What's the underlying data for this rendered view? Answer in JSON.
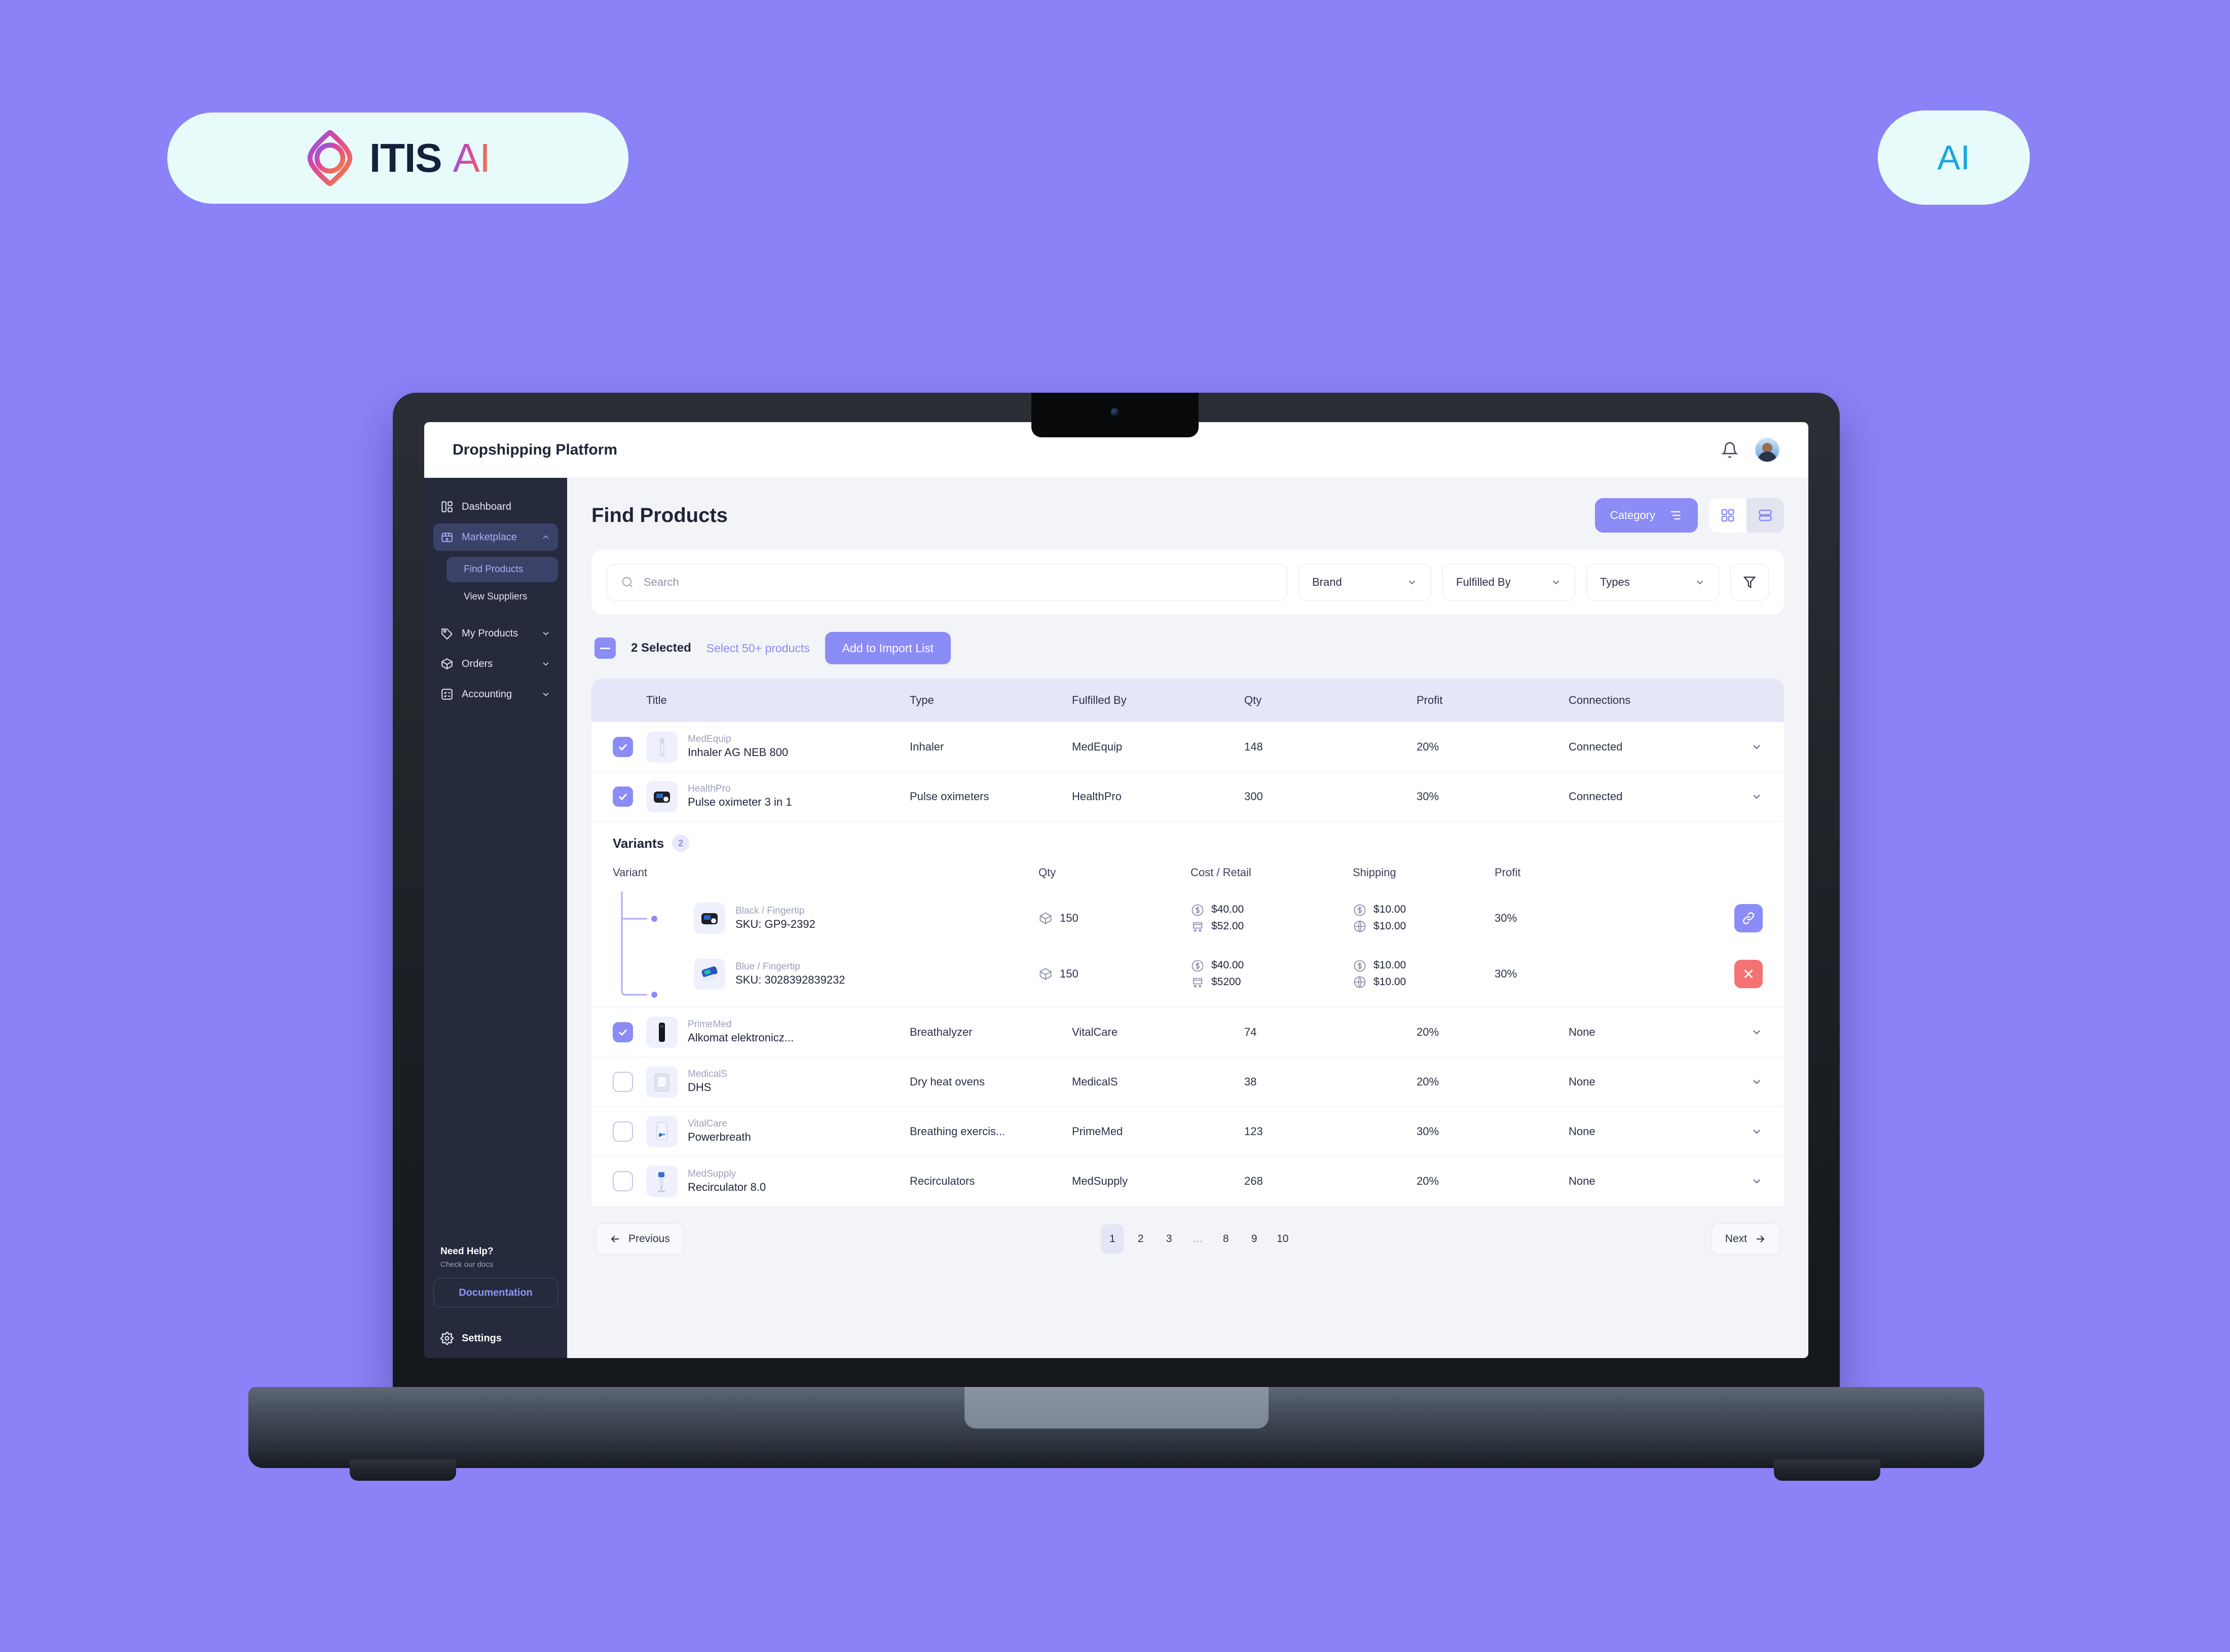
{
  "branding": {
    "logo_text": "ITIS",
    "logo_accent": "AI",
    "badge_text": "AI",
    "accent_color": "#8b8cf5",
    "background_color": "#8b82f8",
    "pill_background": "#e8fbfb",
    "badge_color": "#19a7dd"
  },
  "appbar": {
    "title": "Dropshipping Platform",
    "bell_icon": "bell-icon",
    "avatar_icon": "avatar"
  },
  "sidebar": {
    "items": [
      {
        "label": "Dashboard",
        "icon": "layout-dashboard-icon",
        "active": false,
        "chevron": ""
      },
      {
        "label": "Marketplace",
        "icon": "marketplace-icon",
        "active": true,
        "chevron": "up"
      },
      {
        "label": "My Products",
        "icon": "tag-icon",
        "active": false,
        "chevron": "down"
      },
      {
        "label": "Orders",
        "icon": "package-icon",
        "active": false,
        "chevron": "down"
      },
      {
        "label": "Accounting",
        "icon": "list-checks-icon",
        "active": false,
        "chevron": "down"
      }
    ],
    "subitems": [
      {
        "label": "Find Products",
        "active": true
      },
      {
        "label": "View Suppliers",
        "active": false
      }
    ],
    "help": {
      "title": "Need Help?",
      "subtitle": "Check our docs",
      "button_label": "Documentation"
    },
    "settings_label": "Settings",
    "settings_icon": "gear-icon"
  },
  "main": {
    "page_title": "Find Products",
    "category_button": "Category",
    "category_icon": "sliders-icon",
    "view_grid_icon": "grid-view-icon",
    "view_list_icon": "list-view-icon",
    "search": {
      "placeholder": "Search",
      "value": "",
      "icon": "search-icon"
    },
    "filters": [
      {
        "label": "Brand",
        "icon": "chevron-down-icon"
      },
      {
        "label": "Fulfilled By",
        "icon": "chevron-down-icon"
      },
      {
        "label": "Types",
        "icon": "chevron-down-icon"
      }
    ],
    "funnel_icon": "filter-funnel-icon",
    "selection": {
      "minus_icon": "minus-icon",
      "count_label": "2 Selected",
      "select_more_label": "Select 50+ products",
      "import_button": "Add to Import List"
    },
    "table": {
      "columns": [
        "Title",
        "Type",
        "Fulfilled By",
        "Qty",
        "Profit",
        "Connections"
      ],
      "rows": [
        {
          "checked": true,
          "brand": "MedEquip",
          "title": "Inhaler AG NEB 800",
          "type": "Inhaler",
          "fulfilled_by": "MedEquip",
          "qty": "148",
          "profit": "20%",
          "connection": "Connected",
          "thumb": "inhaler-thumb"
        },
        {
          "checked": true,
          "brand": "HealthPro",
          "title": "Pulse oximeter 3 in 1",
          "type": "Pulse oximeters",
          "fulfilled_by": "HealthPro",
          "qty": "300",
          "profit": "30%",
          "connection": "Connected",
          "thumb": "oximeter-black-thumb"
        },
        {
          "checked": true,
          "brand": "PrimeMed",
          "title": "Alkomat elektronicz...",
          "type": "Breathalyzer",
          "fulfilled_by": "VitalCare",
          "qty": "74",
          "profit": "20%",
          "connection": "None",
          "thumb": "breathalyzer-thumb"
        },
        {
          "checked": false,
          "brand": "MedicalS",
          "title": "DHS",
          "type": "Dry heat ovens",
          "fulfilled_by": "MedicalS",
          "qty": "38",
          "profit": "20%",
          "connection": "None",
          "thumb": "oven-thumb"
        },
        {
          "checked": false,
          "brand": "VitalCare",
          "title": "Powerbreath",
          "type": "Breathing exercis...",
          "fulfilled_by": "PrimeMed",
          "qty": "123",
          "profit": "30%",
          "connection": "None",
          "thumb": "powerbreath-thumb"
        },
        {
          "checked": false,
          "brand": "MedSupply",
          "title": "Recirculator 8.0",
          "type": "Recirculators",
          "fulfilled_by": "MedSupply",
          "qty": "268",
          "profit": "20%",
          "connection": "None",
          "thumb": "recirculator-thumb"
        }
      ]
    },
    "variants": {
      "title": "Variants",
      "count": "2",
      "columns": [
        "Variant",
        "Qty",
        "Cost / Retail",
        "Shipping",
        "Profit"
      ],
      "rows": [
        {
          "option": "Black / Fingertip",
          "sku": "SKU: GP9-2392",
          "qty": "150",
          "cost": "$40.00",
          "retail": "$52.00",
          "ship_cost": "$10.00",
          "ship_global": "$10.00",
          "profit": "30%",
          "action": "link",
          "thumb": "oximeter-black-thumb"
        },
        {
          "option": "Blue / Fingertip",
          "sku": "SKU: 3028392839232",
          "qty": "150",
          "cost": "$40.00",
          "retail": "$5200",
          "ship_cost": "$10.00",
          "ship_global": "$10.00",
          "profit": "30%",
          "action": "delete",
          "thumb": "oximeter-blue-thumb"
        }
      ]
    },
    "pagination": {
      "previous_label": "Previous",
      "next_label": "Next",
      "pages": [
        "1",
        "2",
        "3",
        "…",
        "8",
        "9",
        "10"
      ],
      "current": "1"
    }
  }
}
